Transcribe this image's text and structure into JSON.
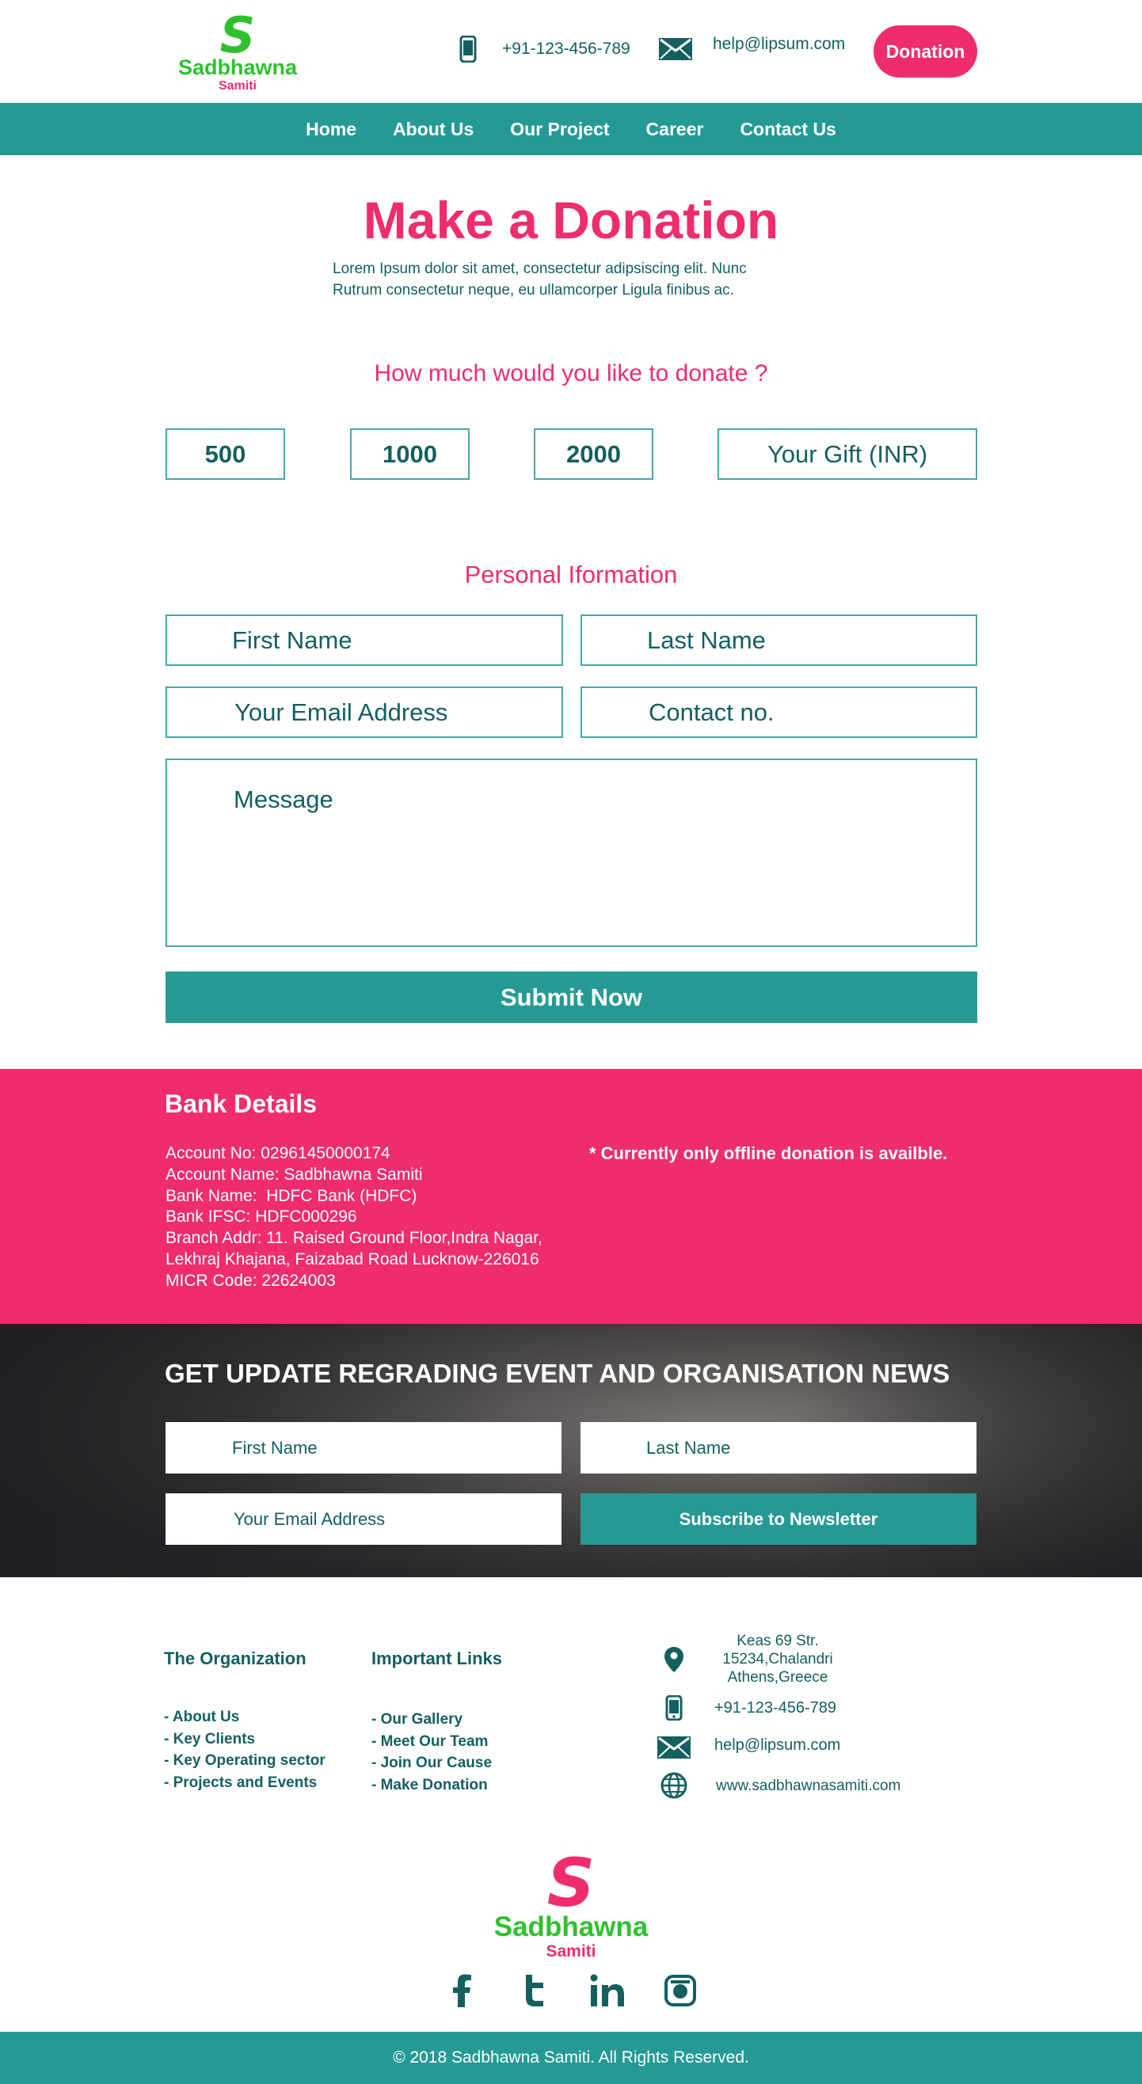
{
  "header": {
    "logo": {
      "letter": "S",
      "name": "Sadbhawna",
      "sub": "Samiti"
    },
    "phone": "+91-123-456-789",
    "email": "help@lipsum.com",
    "donate_button": "Donation"
  },
  "nav": {
    "items": [
      "Home",
      "About Us",
      "Our Project",
      "Career",
      "Contact Us"
    ]
  },
  "donation": {
    "title": "Make a Donation",
    "subtitle_line1": "Lorem Ipsum dolor sit amet, consectetur adipsiscing elit. Nunc",
    "subtitle_line2": "Rutrum consectetur neque, eu ullamcorper Ligula finibus ac.",
    "question": "How much would you like to donate ?",
    "amounts": [
      "500",
      "1000",
      "2000"
    ],
    "gift_placeholder": "Your Gift (INR)"
  },
  "personal": {
    "title": "Personal Iformation",
    "first_name": "First Name",
    "last_name": "Last Name",
    "email": "Your Email Address",
    "contact": "Contact no.",
    "message": "Message",
    "submit": "Submit Now"
  },
  "bank": {
    "title": "Bank Details",
    "lines": [
      "Account No: 02961450000174",
      "Account Name: Sadbhawna Samiti",
      "Bank Name:  HDFC Bank (HDFC)",
      "Bank IFSC: HDFC000296",
      "Branch Addr: 11. Raised Ground Floor,Indra Nagar,",
      "Lekhraj Khajana, Faizabad Road Lucknow-226016",
      "MICR Code: 22624003"
    ],
    "note": "* Currently only offline donation is availble."
  },
  "newsletter": {
    "title": "GET UPDATE REGRADING EVENT AND ORGANISATION NEWS",
    "first_name": "First Name",
    "last_name": "Last Name",
    "email": "Your Email Address",
    "button": "Subscribe to Newsletter"
  },
  "footer": {
    "org_title": "The Organization",
    "org_links": [
      "- About Us",
      "- Key Clients",
      "- Key Operating sector",
      "- Projects and Events"
    ],
    "links_title": "Important Links",
    "important_links": [
      "- Our Gallery",
      "- Meet Our Team",
      "- Join Our Cause",
      "- Make Donation"
    ],
    "address_lines": [
      "Keas 69 Str.",
      "15234,Chalandri",
      "Athens,Greece"
    ],
    "phone": "+91-123-456-789",
    "email": "help@lipsum.com",
    "website": "www.sadbhawnasamiti.com",
    "copyright": "© 2018 Sadbhawna Samiti. All Rights Reserved."
  },
  "icons": {
    "phone": "phone-icon",
    "mail": "mail-icon",
    "location": "location-pin-icon",
    "globe": "globe-icon",
    "social": [
      "facebook-icon",
      "twitter-icon",
      "linkedin-icon",
      "instagram-icon"
    ]
  },
  "colors": {
    "teal": "#259a95",
    "pink": "#ef2d6e",
    "dark_teal": "#145f5f",
    "logo_green": "#2ec12e"
  }
}
